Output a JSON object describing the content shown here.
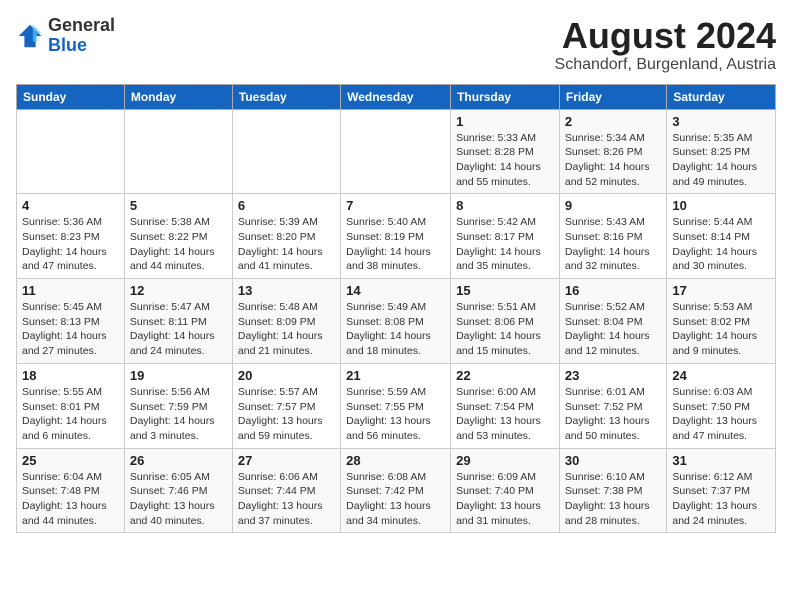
{
  "header": {
    "logo_general": "General",
    "logo_blue": "Blue",
    "month_title": "August 2024",
    "subtitle": "Schandorf, Burgenland, Austria"
  },
  "weekdays": [
    "Sunday",
    "Monday",
    "Tuesday",
    "Wednesday",
    "Thursday",
    "Friday",
    "Saturday"
  ],
  "weeks": [
    [
      {
        "day": "",
        "info": ""
      },
      {
        "day": "",
        "info": ""
      },
      {
        "day": "",
        "info": ""
      },
      {
        "day": "",
        "info": ""
      },
      {
        "day": "1",
        "info": "Sunrise: 5:33 AM\nSunset: 8:28 PM\nDaylight: 14 hours and 55 minutes."
      },
      {
        "day": "2",
        "info": "Sunrise: 5:34 AM\nSunset: 8:26 PM\nDaylight: 14 hours and 52 minutes."
      },
      {
        "day": "3",
        "info": "Sunrise: 5:35 AM\nSunset: 8:25 PM\nDaylight: 14 hours and 49 minutes."
      }
    ],
    [
      {
        "day": "4",
        "info": "Sunrise: 5:36 AM\nSunset: 8:23 PM\nDaylight: 14 hours and 47 minutes."
      },
      {
        "day": "5",
        "info": "Sunrise: 5:38 AM\nSunset: 8:22 PM\nDaylight: 14 hours and 44 minutes."
      },
      {
        "day": "6",
        "info": "Sunrise: 5:39 AM\nSunset: 8:20 PM\nDaylight: 14 hours and 41 minutes."
      },
      {
        "day": "7",
        "info": "Sunrise: 5:40 AM\nSunset: 8:19 PM\nDaylight: 14 hours and 38 minutes."
      },
      {
        "day": "8",
        "info": "Sunrise: 5:42 AM\nSunset: 8:17 PM\nDaylight: 14 hours and 35 minutes."
      },
      {
        "day": "9",
        "info": "Sunrise: 5:43 AM\nSunset: 8:16 PM\nDaylight: 14 hours and 32 minutes."
      },
      {
        "day": "10",
        "info": "Sunrise: 5:44 AM\nSunset: 8:14 PM\nDaylight: 14 hours and 30 minutes."
      }
    ],
    [
      {
        "day": "11",
        "info": "Sunrise: 5:45 AM\nSunset: 8:13 PM\nDaylight: 14 hours and 27 minutes."
      },
      {
        "day": "12",
        "info": "Sunrise: 5:47 AM\nSunset: 8:11 PM\nDaylight: 14 hours and 24 minutes."
      },
      {
        "day": "13",
        "info": "Sunrise: 5:48 AM\nSunset: 8:09 PM\nDaylight: 14 hours and 21 minutes."
      },
      {
        "day": "14",
        "info": "Sunrise: 5:49 AM\nSunset: 8:08 PM\nDaylight: 14 hours and 18 minutes."
      },
      {
        "day": "15",
        "info": "Sunrise: 5:51 AM\nSunset: 8:06 PM\nDaylight: 14 hours and 15 minutes."
      },
      {
        "day": "16",
        "info": "Sunrise: 5:52 AM\nSunset: 8:04 PM\nDaylight: 14 hours and 12 minutes."
      },
      {
        "day": "17",
        "info": "Sunrise: 5:53 AM\nSunset: 8:02 PM\nDaylight: 14 hours and 9 minutes."
      }
    ],
    [
      {
        "day": "18",
        "info": "Sunrise: 5:55 AM\nSunset: 8:01 PM\nDaylight: 14 hours and 6 minutes."
      },
      {
        "day": "19",
        "info": "Sunrise: 5:56 AM\nSunset: 7:59 PM\nDaylight: 14 hours and 3 minutes."
      },
      {
        "day": "20",
        "info": "Sunrise: 5:57 AM\nSunset: 7:57 PM\nDaylight: 13 hours and 59 minutes."
      },
      {
        "day": "21",
        "info": "Sunrise: 5:59 AM\nSunset: 7:55 PM\nDaylight: 13 hours and 56 minutes."
      },
      {
        "day": "22",
        "info": "Sunrise: 6:00 AM\nSunset: 7:54 PM\nDaylight: 13 hours and 53 minutes."
      },
      {
        "day": "23",
        "info": "Sunrise: 6:01 AM\nSunset: 7:52 PM\nDaylight: 13 hours and 50 minutes."
      },
      {
        "day": "24",
        "info": "Sunrise: 6:03 AM\nSunset: 7:50 PM\nDaylight: 13 hours and 47 minutes."
      }
    ],
    [
      {
        "day": "25",
        "info": "Sunrise: 6:04 AM\nSunset: 7:48 PM\nDaylight: 13 hours and 44 minutes."
      },
      {
        "day": "26",
        "info": "Sunrise: 6:05 AM\nSunset: 7:46 PM\nDaylight: 13 hours and 40 minutes."
      },
      {
        "day": "27",
        "info": "Sunrise: 6:06 AM\nSunset: 7:44 PM\nDaylight: 13 hours and 37 minutes."
      },
      {
        "day": "28",
        "info": "Sunrise: 6:08 AM\nSunset: 7:42 PM\nDaylight: 13 hours and 34 minutes."
      },
      {
        "day": "29",
        "info": "Sunrise: 6:09 AM\nSunset: 7:40 PM\nDaylight: 13 hours and 31 minutes."
      },
      {
        "day": "30",
        "info": "Sunrise: 6:10 AM\nSunset: 7:38 PM\nDaylight: 13 hours and 28 minutes."
      },
      {
        "day": "31",
        "info": "Sunrise: 6:12 AM\nSunset: 7:37 PM\nDaylight: 13 hours and 24 minutes."
      }
    ]
  ]
}
